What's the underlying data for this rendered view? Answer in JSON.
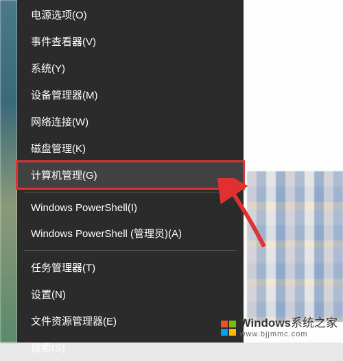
{
  "menu": {
    "items": [
      {
        "label": "电源选项(O)",
        "highlighted": false
      },
      {
        "label": "事件查看器(V)",
        "highlighted": false
      },
      {
        "label": "系统(Y)",
        "highlighted": false
      },
      {
        "label": "设备管理器(M)",
        "highlighted": false
      },
      {
        "label": "网络连接(W)",
        "highlighted": false
      },
      {
        "label": "磁盘管理(K)",
        "highlighted": false
      },
      {
        "label": "计算机管理(G)",
        "highlighted": true
      }
    ],
    "items2": [
      {
        "label": "Windows PowerShell(I)",
        "highlighted": false
      },
      {
        "label": "Windows PowerShell (管理员)(A)",
        "highlighted": false
      }
    ],
    "items3": [
      {
        "label": "任务管理器(T)",
        "highlighted": false
      },
      {
        "label": "设置(N)",
        "highlighted": false
      },
      {
        "label": "文件资源管理器(E)",
        "highlighted": false
      },
      {
        "label": "搜索(S)",
        "highlighted": false
      }
    ]
  },
  "annotation": {
    "highlight_color": "#e03030",
    "arrow_color": "#e03030"
  },
  "watermark": {
    "brand": "Windows",
    "suffix": "系统之家",
    "url": "www.bjjmmc.com"
  }
}
